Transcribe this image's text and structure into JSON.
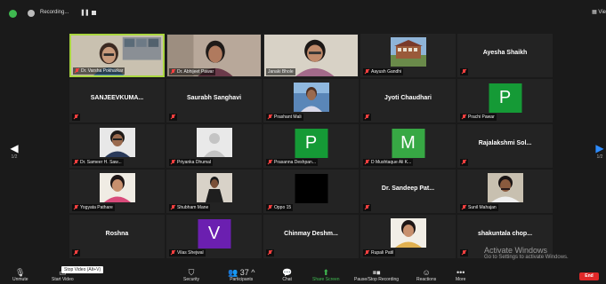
{
  "topbar": {
    "recording_label": "Recording...",
    "view_label": "Vie"
  },
  "nav": {
    "left_count": "1/2",
    "right_count": "1/2"
  },
  "tiles": [
    {
      "name": "Dr. Varsha Pokharkar",
      "type": "video",
      "active": true
    },
    {
      "name": "Dr. Abhijeet Pawar",
      "type": "video"
    },
    {
      "name": "Janaki Bhole",
      "type": "video"
    },
    {
      "name": "Aayush Gandhi",
      "type": "photo"
    },
    {
      "big": "Ayesha Shaikh",
      "type": "name"
    },
    {
      "big": "SANJEEVKUMA...",
      "type": "name"
    },
    {
      "big": "Saurabh Sanghavi",
      "type": "name"
    },
    {
      "name": "Prashant Mali",
      "type": "photo"
    },
    {
      "big": "Jyoti Chaudhari",
      "type": "name"
    },
    {
      "name": "Prachi Pawar",
      "type": "letter",
      "letter": "P",
      "color": "#159a36"
    },
    {
      "name": "Dr. Sameer H. Saw...",
      "type": "photo"
    },
    {
      "name": "Priyanka Dhumal",
      "type": "photo"
    },
    {
      "name": "Prasanna Deshpan...",
      "type": "letter",
      "letter": "P",
      "color": "#159a36"
    },
    {
      "name": "D Mushtaque Ali K...",
      "type": "letter",
      "letter": "M",
      "color": "#37a844"
    },
    {
      "big": "Rajalakshmi Sol...",
      "type": "name"
    },
    {
      "name": "Yogyata Pathare",
      "type": "photo"
    },
    {
      "name": "Shubham Mane",
      "type": "photo"
    },
    {
      "name": "Oppo 15",
      "type": "black"
    },
    {
      "big": "Dr. Sandeep Pat...",
      "type": "name"
    },
    {
      "name": "Sunil Mahajan",
      "type": "photo"
    },
    {
      "big": "Roshna",
      "type": "name"
    },
    {
      "name": "Vilas Shejwal",
      "type": "letter",
      "letter": "V",
      "color": "#6b1fb0"
    },
    {
      "big": "Chinmay Deshm...",
      "type": "name"
    },
    {
      "name": "Rupali Patil",
      "type": "photo"
    },
    {
      "big": "shakuntala chop...",
      "type": "name"
    }
  ],
  "toolbar": {
    "unmute": "Unmute",
    "start_video": "Start Video",
    "security": "Security",
    "participants": "Participants",
    "participants_count": "37",
    "chat": "Chat",
    "share_screen": "Share Screen",
    "pause_recording": "Pause/Stop Recording",
    "reactions": "Reactions",
    "more": "More",
    "end": "End",
    "tooltip": "Stop Video (Alt+V)"
  },
  "watermark": {
    "line1": "Activate Windows",
    "line2": "Go to Settings to activate Windows."
  },
  "colors": {
    "background": "#1a1a1a",
    "tile": "#232323",
    "active_border": "#a9d63f",
    "muted_mic": "#ff4040",
    "end_button": "#e02828",
    "share_green": "#3fb950",
    "nav_blue": "#2d8cff"
  }
}
